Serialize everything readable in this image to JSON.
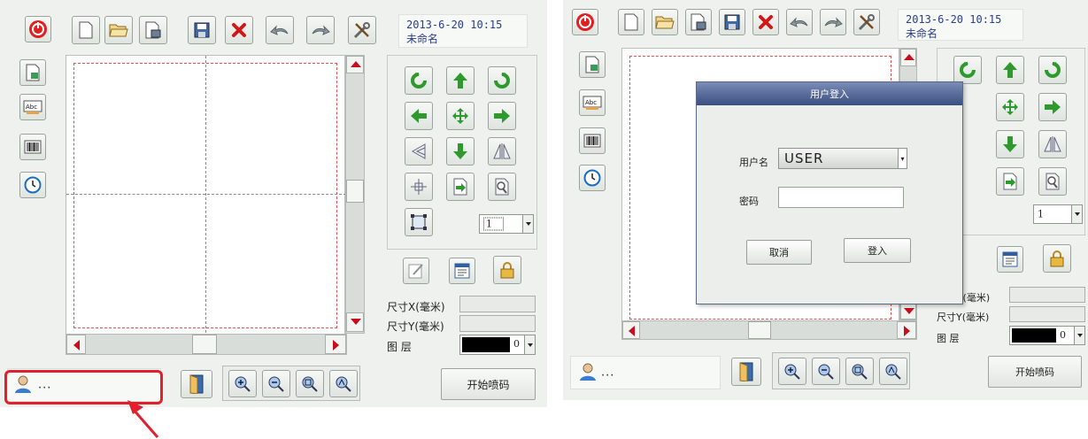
{
  "left_screen": {
    "datetime": "2013-6-20 10:15",
    "filename": "未命名",
    "size_x_label": "尺寸X(毫米)",
    "size_y_label": "尺寸Y(毫米)",
    "layer_label": "图 层",
    "layer_value": "0",
    "step_value": "1",
    "status_user": "...",
    "start_button": "开始喷码",
    "highlight_color": "#e0202c"
  },
  "right_screen": {
    "datetime": "2013-6-20 10:15",
    "filename": "未命名",
    "size_x_label": "尺寸X(毫米)",
    "size_y_label": "尺寸Y(毫米)",
    "layer_label": "图 层",
    "layer_value": "0",
    "step_value": "1",
    "status_user": "...",
    "start_button": "开始喷码",
    "dialog": {
      "title": "用户登入",
      "username_label": "用户名",
      "username_value": "USER",
      "password_label": "密码",
      "password_value": "",
      "cancel_button": "取消",
      "login_button": "登入"
    }
  },
  "colors": {
    "power": "#e02020",
    "arrow_green": "#2e9a2e",
    "dialog_title": "#3a4e82",
    "delete_red": "#d01818"
  }
}
